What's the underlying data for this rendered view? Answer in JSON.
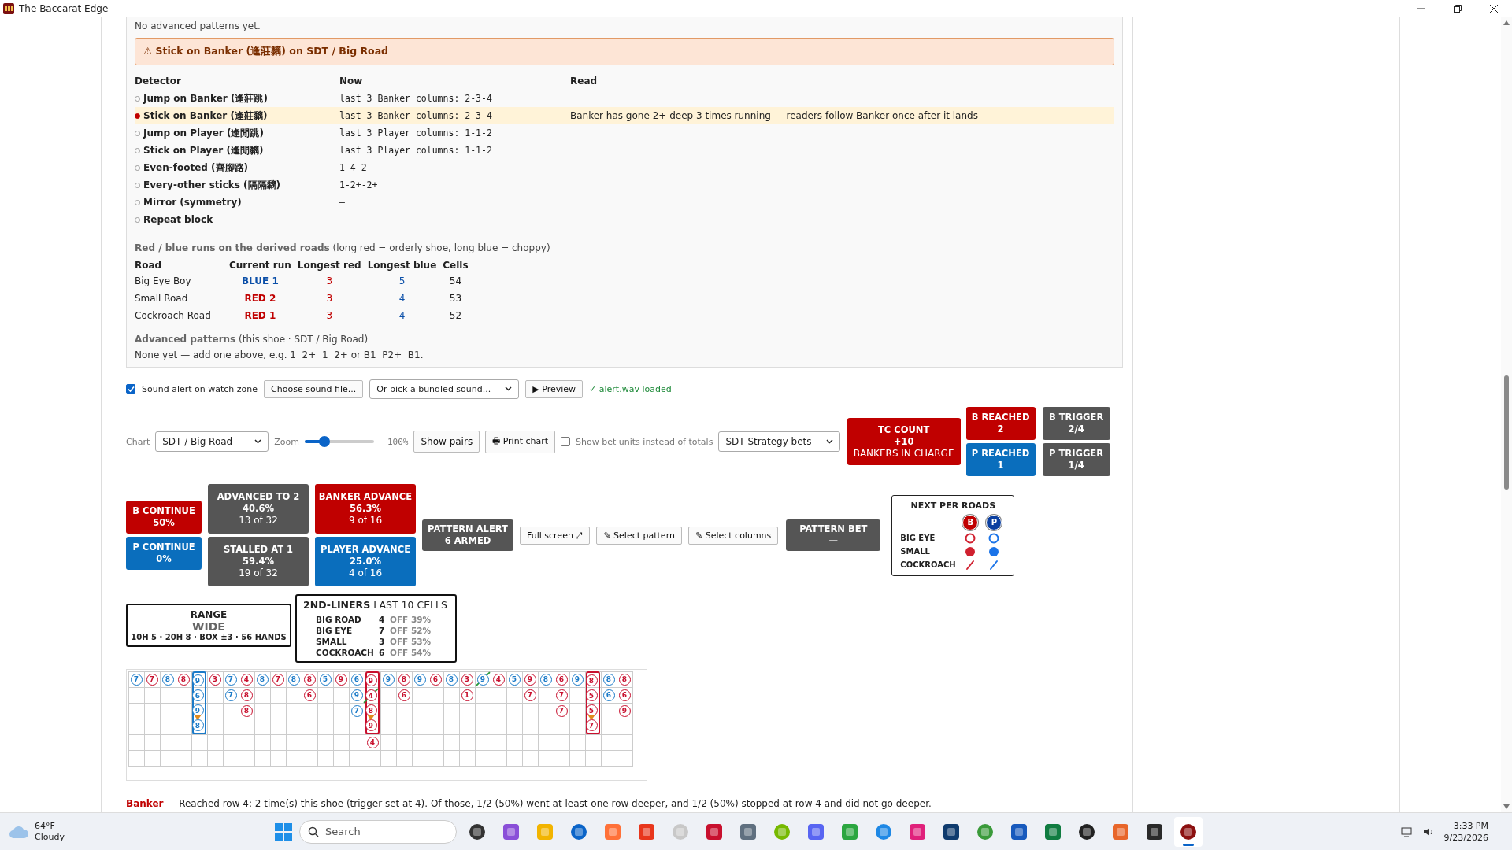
{
  "window": {
    "title": "The Baccarat Edge"
  },
  "panel": {
    "note": "No advanced patterns yet.",
    "alert": "⚠ Stick on Banker (逢莊黐) on SDT / Big Road",
    "detector_columns": [
      "Detector",
      "Now",
      "Read"
    ],
    "detectors": [
      {
        "name": "Jump on Banker (逢莊跳)",
        "now": "last 3 Banker columns: 2-3-4",
        "active": false
      },
      {
        "name": "Stick on Banker (逢莊黐)",
        "now": "last 3 Banker columns: 2-3-4",
        "read": "Banker has gone 2+ deep 3 times running — readers follow Banker once after it lands",
        "active": true
      },
      {
        "name": "Jump on Player (逢閒跳)",
        "now": "last 3 Player columns: 1-1-2",
        "active": false
      },
      {
        "name": "Stick on Player (逢閒黐)",
        "now": "last 3 Player columns: 1-1-2",
        "active": false
      },
      {
        "name": "Even-footed (齊腳路)",
        "now": "1-4-2",
        "active": false
      },
      {
        "name": "Every-other sticks (隔隔黐)",
        "now": "1-2+-2+",
        "active": false
      },
      {
        "name": "Mirror (symmetry)",
        "now": "–",
        "active": false
      },
      {
        "name": "Repeat block",
        "now": "–",
        "active": false
      }
    ],
    "runs_title": "**Red / blue runs on the derived roads** (long red = orderly shoe, long blue = choppy)",
    "runs_columns": [
      "Road",
      "Current run",
      "Longest red",
      "Longest blue",
      "Cells"
    ],
    "runs": [
      {
        "road": "Big Eye Boy",
        "current_run": "BLUE 1",
        "color": "#0b4fa8",
        "longest_red": "3",
        "longest_blue": "5",
        "cells": "54"
      },
      {
        "road": "Small Road",
        "current_run": "RED 2",
        "color": "#c00000",
        "longest_red": "3",
        "longest_blue": "4",
        "cells": "53"
      },
      {
        "road": "Cockroach Road",
        "current_run": "RED 1",
        "color": "#c00000",
        "longest_red": "3",
        "longest_blue": "4",
        "cells": "52"
      }
    ],
    "advanced_title": "**Advanced patterns** (this shoe · SDT / Big Road)",
    "advanced_hint": "None yet — add one above, e.g. 1  2+  1  2+ or B1  P2+  B1."
  },
  "sound": {
    "checkbox": {
      "label": "Sound alert on watch zone",
      "checked": true
    },
    "choose_button": "Choose sound file...",
    "bundled_select": "Or pick a bundled sound...",
    "preview_button": "▶ Preview",
    "status": "✓ alert.wav loaded"
  },
  "chart_controls": {
    "chart_label": "Chart",
    "chart_select": "SDT / Big Road",
    "zoom_label": "Zoom",
    "zoom": {
      "level": 0.28
    },
    "zoom_reading": "100%",
    "show_pairs": "Show pairs",
    "print_chart": "🖶 Print chart",
    "bet_units": {
      "label": "Show bet units instead of totals",
      "checked": false
    },
    "strategy_select": "SDT Strategy bets"
  },
  "tc_count": {
    "title": "TC COUNT",
    "value": "+10",
    "detail": "BANKERS IN CHARGE",
    "color": "#c00000"
  },
  "reach_tiles": [
    {
      "title": "B REACHED",
      "value": "2",
      "color": "#c00000"
    },
    {
      "title": "B TRIGGER",
      "value": "2/4",
      "color": "#555555"
    },
    {
      "title": "P REACHED",
      "value": "1",
      "color": "#0a6ebd"
    },
    {
      "title": "P TRIGGER",
      "value": "1/4",
      "color": "#555555"
    }
  ],
  "stat_stacks": [
    [
      {
        "title": "B CONTINUE",
        "value": "50%",
        "color": "#c00000"
      },
      {
        "title": "P CONTINUE",
        "value": "0%",
        "color": "#0a6ebd"
      }
    ],
    [
      {
        "title": "ADVANCED TO 2",
        "value": "40.6%",
        "detail": "13 of 32",
        "color": "#555555"
      },
      {
        "title": "STALLED AT 1",
        "value": "59.4%",
        "detail": "19 of 32",
        "color": "#555555"
      }
    ],
    [
      {
        "title": "BANKER ADVANCE",
        "value": "56.3%",
        "detail": "9 of 16",
        "color": "#c00000"
      },
      {
        "title": "PLAYER ADVANCE",
        "value": "25.0%",
        "detail": "4 of 16",
        "color": "#0a6ebd"
      }
    ]
  ],
  "pattern_alert": {
    "title": "PATTERN ALERT",
    "value": "6 ARMED",
    "color": "#555555"
  },
  "pattern_buttons": [
    "Full screen ⤢",
    "✎ Select pattern",
    "✎ Select columns"
  ],
  "pattern_bet": {
    "title": "PATTERN BET",
    "value": "—",
    "color": "#555555"
  },
  "next_per_roads": {
    "title": "NEXT PER ROADS",
    "headers": [
      {
        "label": "B",
        "color": "#c00000"
      },
      {
        "label": "P",
        "color": "#0b3fa0"
      }
    ],
    "rows": [
      {
        "road": "BIG EYE",
        "kind": "ring"
      },
      {
        "road": "SMALL",
        "kind": "dot"
      },
      {
        "road": "COCKROACH",
        "kind": "slash"
      }
    ]
  },
  "range": {
    "title": "RANGE",
    "value": "WIDE",
    "detail": "10H 5 · 20H 8 · BOX ±3 · 56 HANDS"
  },
  "second_liners": {
    "title": "**2ND-LINERS** LAST 10 CELLS",
    "rows": [
      {
        "road": "BIG ROAD",
        "count": "4",
        "off": "OFF 39%"
      },
      {
        "road": "BIG EYE",
        "count": "7",
        "off": "OFF 52%"
      },
      {
        "road": "SMALL",
        "count": "3",
        "off": "OFF 53%"
      },
      {
        "road": "COCKROACH",
        "count": "6",
        "off": "OFF 54%"
      }
    ]
  },
  "big_road": {
    "columns": [
      [
        {
          "v": "7",
          "color": "#1a7ac8",
          "tie": false,
          "marked": false,
          "boxed": false
        }
      ],
      [
        {
          "v": "7",
          "color": "#c8102e",
          "tie": false,
          "marked": false,
          "boxed": false
        }
      ],
      [
        {
          "v": "8",
          "color": "#1a7ac8",
          "tie": false,
          "marked": false,
          "boxed": false
        }
      ],
      [
        {
          "v": "8",
          "color": "#c8102e",
          "tie": false,
          "marked": false,
          "boxed": false
        }
      ],
      [
        {
          "v": "9",
          "color": "#1a7ac8",
          "tie": false,
          "marked": false,
          "boxed": true
        },
        {
          "v": "6",
          "color": "#1a7ac8",
          "tie": false,
          "marked": false,
          "boxed": true
        },
        {
          "v": "9",
          "color": "#1a7ac8",
          "tie": false,
          "marked": false,
          "boxed": true
        },
        {
          "v": "8",
          "color": "#1a7ac8",
          "tie": false,
          "marked": true,
          "boxed": true
        }
      ],
      [
        {
          "v": "3",
          "color": "#c8102e",
          "tie": false,
          "marked": false,
          "boxed": false
        }
      ],
      [
        {
          "v": "7",
          "color": "#1a7ac8",
          "tie": false,
          "marked": false,
          "boxed": false
        },
        {
          "v": "7",
          "color": "#1a7ac8",
          "tie": false,
          "marked": false,
          "boxed": false
        }
      ],
      [
        {
          "v": "4",
          "color": "#c8102e",
          "tie": false,
          "marked": false,
          "boxed": false
        },
        {
          "v": "8",
          "color": "#c8102e",
          "tie": false,
          "marked": false,
          "boxed": false
        },
        {
          "v": "8",
          "color": "#c8102e",
          "tie": false,
          "marked": false,
          "boxed": false
        }
      ],
      [
        {
          "v": "8",
          "color": "#1a7ac8",
          "tie": false,
          "marked": false,
          "boxed": false
        }
      ],
      [
        {
          "v": "7",
          "color": "#c8102e",
          "tie": false,
          "marked": false,
          "boxed": false
        }
      ],
      [
        {
          "v": "8",
          "color": "#1a7ac8",
          "tie": false,
          "marked": false,
          "boxed": false
        }
      ],
      [
        {
          "v": "8",
          "color": "#c8102e",
          "tie": false,
          "marked": false,
          "boxed": false
        },
        {
          "v": "6",
          "color": "#c8102e",
          "tie": false,
          "marked": false,
          "boxed": false
        }
      ],
      [
        {
          "v": "5",
          "color": "#1a7ac8",
          "tie": false,
          "marked": false,
          "boxed": false
        }
      ],
      [
        {
          "v": "9",
          "color": "#c8102e",
          "tie": false,
          "marked": false,
          "boxed": false
        }
      ],
      [
        {
          "v": "6",
          "color": "#1a7ac8",
          "tie": false,
          "marked": false,
          "boxed": false
        },
        {
          "v": "9",
          "color": "#1a7ac8",
          "tie": false,
          "marked": false,
          "boxed": false
        },
        {
          "v": "7",
          "color": "#1a7ac8",
          "tie": false,
          "marked": false,
          "boxed": false
        }
      ],
      [
        {
          "v": "9",
          "color": "#c8102e",
          "tie": false,
          "marked": false,
          "boxed": true
        },
        {
          "v": "4",
          "color": "#c8102e",
          "tie": true,
          "marked": false,
          "boxed": true
        },
        {
          "v": "8",
          "color": "#c8102e",
          "tie": false,
          "marked": false,
          "boxed": true
        },
        {
          "v": "9",
          "color": "#c8102e",
          "tie": false,
          "marked": true,
          "boxed": true
        },
        {
          "v": "4",
          "color": "#c8102e",
          "tie": false,
          "marked": false,
          "boxed": false
        }
      ],
      [
        {
          "v": "9",
          "color": "#1a7ac8",
          "tie": false,
          "marked": false,
          "boxed": false
        }
      ],
      [
        {
          "v": "8",
          "color": "#c8102e",
          "tie": false,
          "marked": false,
          "boxed": false
        },
        {
          "v": "6",
          "color": "#c8102e",
          "tie": false,
          "marked": false,
          "boxed": false
        }
      ],
      [
        {
          "v": "9",
          "color": "#1a7ac8",
          "tie": false,
          "marked": false,
          "boxed": false
        }
      ],
      [
        {
          "v": "6",
          "color": "#c8102e",
          "tie": false,
          "marked": false,
          "boxed": false
        }
      ],
      [
        {
          "v": "8",
          "color": "#1a7ac8",
          "tie": false,
          "marked": false,
          "boxed": false
        }
      ],
      [
        {
          "v": "3",
          "color": "#c8102e",
          "tie": false,
          "marked": false,
          "boxed": false
        },
        {
          "v": "1",
          "color": "#c8102e",
          "tie": false,
          "marked": false,
          "boxed": false
        }
      ],
      [
        {
          "v": "9",
          "color": "#1a7ac8",
          "tie": true,
          "marked": false,
          "boxed": false
        }
      ],
      [
        {
          "v": "4",
          "color": "#c8102e",
          "tie": false,
          "marked": false,
          "boxed": false
        }
      ],
      [
        {
          "v": "5",
          "color": "#1a7ac8",
          "tie": false,
          "marked": false,
          "boxed": false
        }
      ],
      [
        {
          "v": "9",
          "color": "#c8102e",
          "tie": false,
          "marked": false,
          "boxed": false
        },
        {
          "v": "7",
          "color": "#c8102e",
          "tie": false,
          "marked": false,
          "boxed": false
        }
      ],
      [
        {
          "v": "8",
          "color": "#1a7ac8",
          "tie": false,
          "marked": false,
          "boxed": false
        }
      ],
      [
        {
          "v": "6",
          "color": "#c8102e",
          "tie": false,
          "marked": false,
          "boxed": false
        },
        {
          "v": "7",
          "color": "#c8102e",
          "tie": false,
          "marked": false,
          "boxed": false
        },
        {
          "v": "7",
          "color": "#c8102e",
          "tie": false,
          "marked": false,
          "boxed": false
        }
      ],
      [
        {
          "v": "9",
          "color": "#1a7ac8",
          "tie": false,
          "marked": false,
          "boxed": false
        }
      ],
      [
        {
          "v": "8",
          "color": "#c8102e",
          "tie": false,
          "marked": false,
          "boxed": true
        },
        {
          "v": "5",
          "color": "#c8102e",
          "tie": false,
          "marked": false,
          "boxed": true
        },
        {
          "v": "5",
          "color": "#c8102e",
          "tie": false,
          "marked": false,
          "boxed": true
        },
        {
          "v": "7",
          "color": "#c8102e",
          "tie": false,
          "marked": true,
          "boxed": true
        }
      ],
      [
        {
          "v": "8",
          "color": "#1a7ac8",
          "tie": false,
          "marked": false,
          "boxed": false
        },
        {
          "v": "6",
          "color": "#1a7ac8",
          "tie": false,
          "marked": false,
          "boxed": false
        }
      ],
      [
        {
          "v": "8",
          "color": "#c8102e",
          "tie": false,
          "marked": false,
          "boxed": false
        },
        {
          "v": "6",
          "color": "#c8102e",
          "tie": false,
          "marked": false,
          "boxed": false
        },
        {
          "v": "9",
          "color": "#c8102e",
          "tie": false,
          "marked": false,
          "boxed": false
        }
      ]
    ]
  },
  "footer_note": "**Banker** — Reached row 4: 2 time(s) this shoe (trigger set at 4). Of those, 1/2 (50%) went at least one row deeper, and 1/2 (50%) stopped at row 4 and did not go deeper.",
  "taskbar": {
    "weather": {
      "temp": "64°F",
      "condition": "Cloudy"
    },
    "search": {
      "placeholder": "Search"
    },
    "apps": [
      {
        "selected": false
      },
      {
        "selected": false
      },
      {
        "selected": false
      },
      {
        "selected": false
      },
      {
        "selected": false
      },
      {
        "selected": false
      },
      {
        "selected": false
      },
      {
        "selected": false
      },
      {
        "selected": false
      },
      {
        "selected": false
      },
      {
        "selected": false
      },
      {
        "selected": false
      },
      {
        "selected": false
      },
      {
        "selected": false
      },
      {
        "selected": false
      },
      {
        "selected": false
      },
      {
        "selected": false
      },
      {
        "selected": false
      },
      {
        "selected": false
      },
      {
        "selected": false
      },
      {
        "selected": false
      },
      {
        "selected": true
      }
    ],
    "time": "3:33 PM",
    "date": "9/23/2026"
  }
}
